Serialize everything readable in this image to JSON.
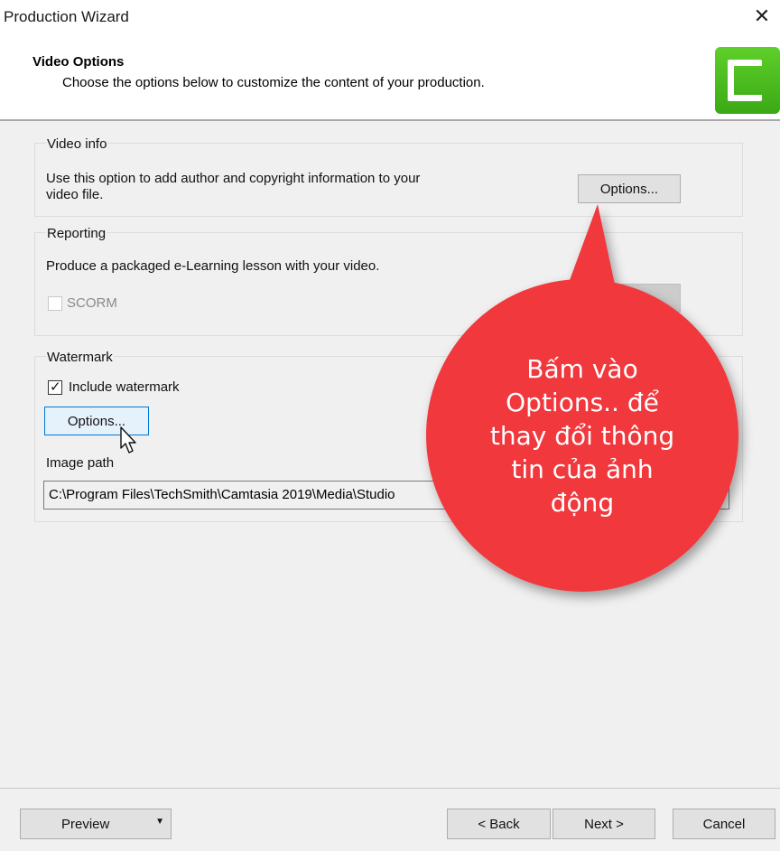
{
  "window": {
    "title": "Production Wizard",
    "close_glyph": "✕"
  },
  "header": {
    "title": "Video Options",
    "subtitle": "Choose the options below to customize the content of your production.",
    "logo_icon": "camtasia-logo-icon"
  },
  "video_info": {
    "label": "Video info",
    "description_line1": "Use this option to add author and copyright information to your",
    "description_line2": "video file.",
    "options_button": "Options..."
  },
  "reporting": {
    "label": "Reporting",
    "description": "Produce a packaged e-Learning lesson with your video.",
    "scorm_label": "SCORM",
    "scorm_checked": false
  },
  "watermark": {
    "label": "Watermark",
    "include_label": "Include watermark",
    "include_checked": true,
    "options_button": "Options...",
    "image_path_label": "Image path",
    "image_path_value": "C:\\Program Files\\TechSmith\\Camtasia 2019\\Media\\Studio"
  },
  "callout": {
    "text_line1": "Bấm vào",
    "text_line2": "Options.. để",
    "text_line3": "thay đổi thông",
    "text_line4": "tin của ảnh",
    "text_line5": "động",
    "color": "#f0383d"
  },
  "footer": {
    "preview_button": "Preview",
    "back_button": "< Back",
    "next_button": "Next >",
    "cancel_button": "Cancel"
  }
}
